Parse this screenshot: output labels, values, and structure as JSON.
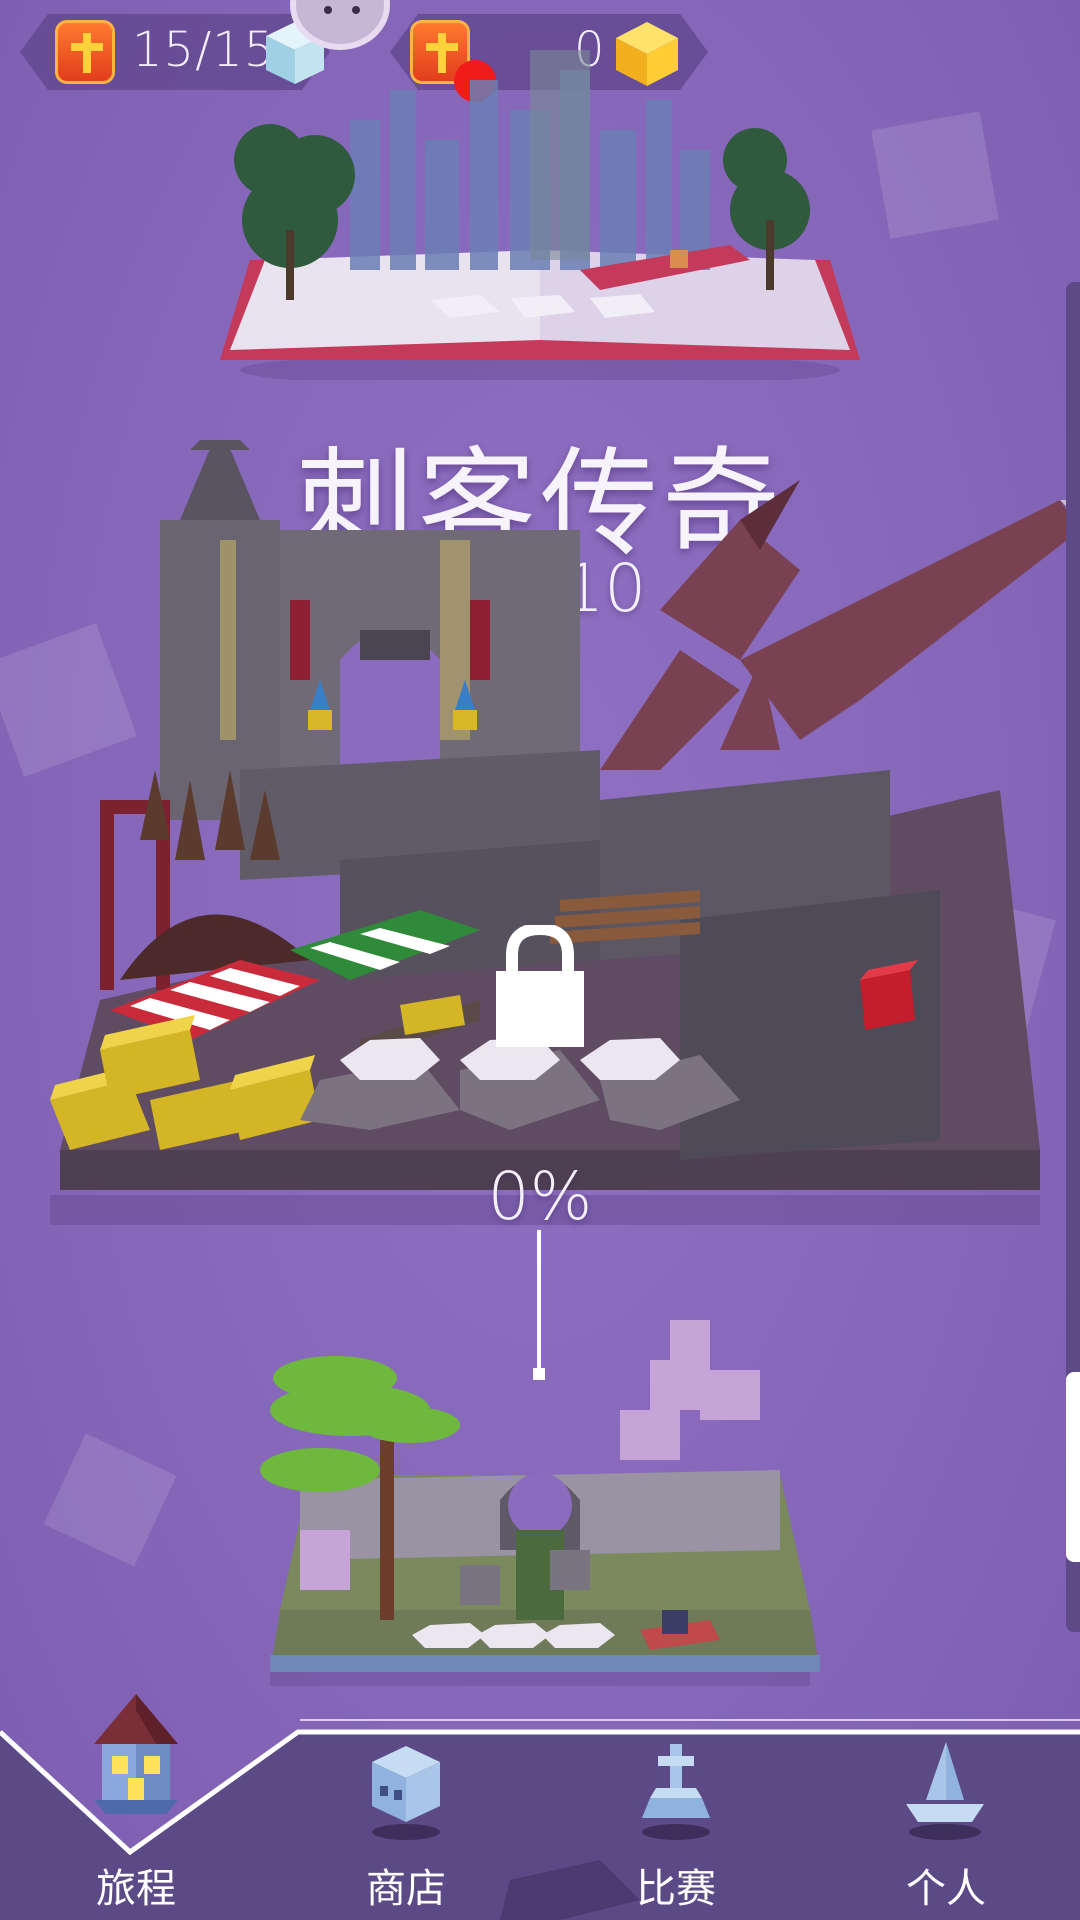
{
  "hud": {
    "lives_value": "15/15",
    "coins_value": "0"
  },
  "level": {
    "title": "刺客传奇",
    "gems_value": "0/10",
    "progress_percent": "0%"
  },
  "nav": {
    "items": [
      {
        "label": "旅程",
        "icon": "house-icon",
        "active": true
      },
      {
        "label": "商店",
        "icon": "skull-cube-icon",
        "active": false
      },
      {
        "label": "比赛",
        "icon": "trophy-icon",
        "active": false
      },
      {
        "label": "个人",
        "icon": "hat-icon",
        "active": false
      }
    ]
  },
  "colors": {
    "background": "#8566b8",
    "nav_background": "#5b4a86",
    "badge_orange": "#e8501f",
    "notify_red": "#f01c1c",
    "gem_gold": "#f6c324"
  }
}
